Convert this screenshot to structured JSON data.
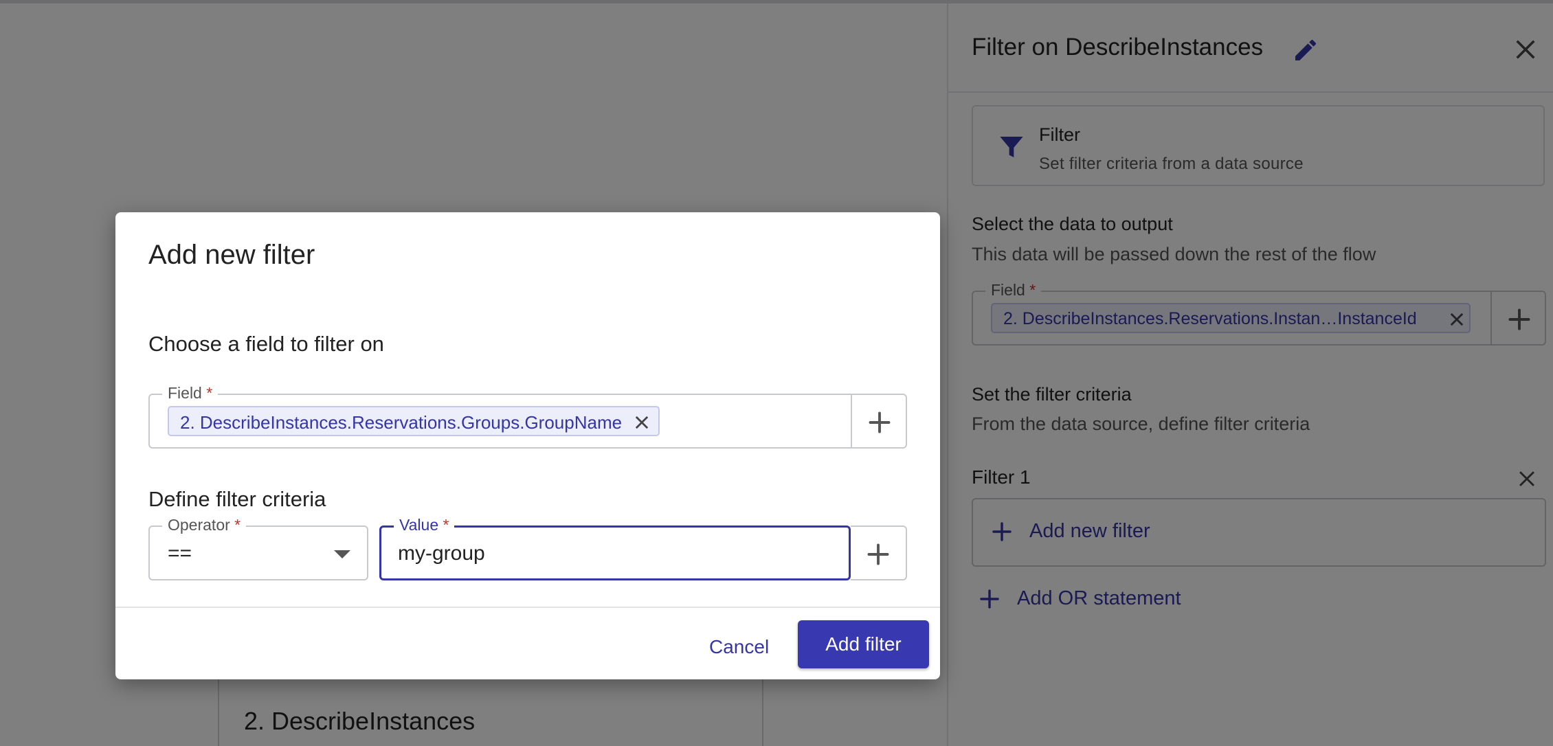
{
  "canvas": {
    "node_title": "2. DescribeInstances"
  },
  "panel": {
    "title": "Filter on DescribeInstances",
    "type_card": {
      "icon": "filter-icon",
      "title": "Filter",
      "subtitle": "Set filter criteria from a data source"
    },
    "output_section": {
      "title": "Select the data to output",
      "subtitle": "This data will be passed down the rest of the flow",
      "field_label": "Field",
      "required_mark": "*",
      "field_chip": "2. DescribeInstances.Reservations.Instan…InstanceId"
    },
    "criteria_section": {
      "title": "Set the filter criteria",
      "subtitle": "From the data source, define filter criteria"
    },
    "filter_group": {
      "label": "Filter 1",
      "add_filter_label": "Add new filter"
    },
    "add_or_label": "Add OR statement"
  },
  "dialog": {
    "title": "Add new filter",
    "field_section_title": "Choose a field to filter on",
    "field_label": "Field",
    "required_mark": "*",
    "field_chip": "2. DescribeInstances.Reservations.Groups.GroupName",
    "criteria_section_title": "Define filter criteria",
    "operator": {
      "label": "Operator",
      "selected": "=="
    },
    "value": {
      "label": "Value",
      "current": "my-group"
    },
    "cancel_label": "Cancel",
    "submit_label": "Add filter"
  },
  "colors": {
    "accent": "#3838b0",
    "chip_bg": "#eceefa",
    "required": "#c9302c"
  }
}
